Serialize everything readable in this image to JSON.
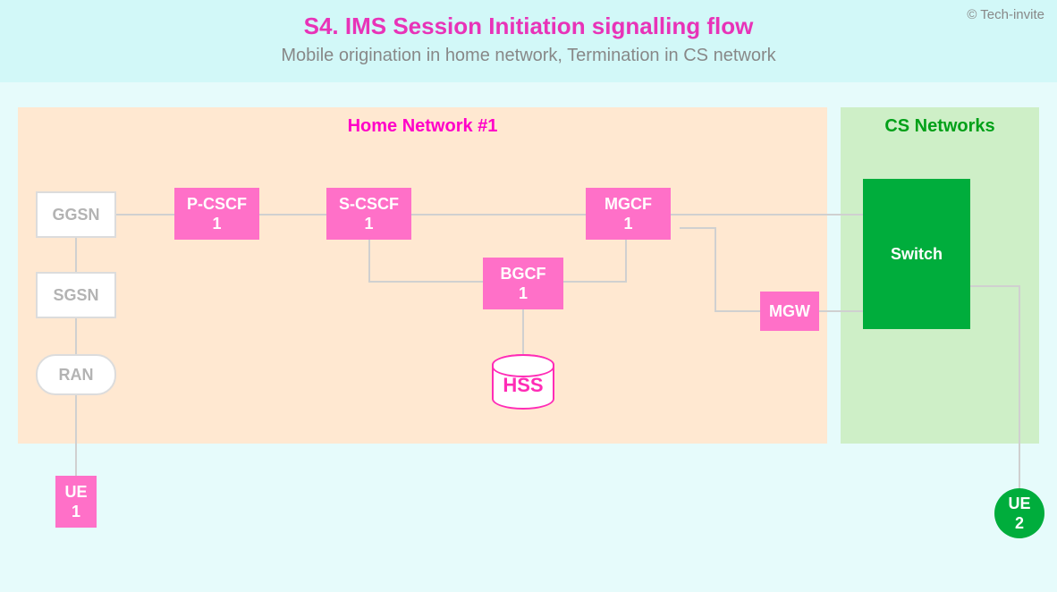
{
  "header": {
    "title": "S4. IMS Session Initiation signalling flow",
    "subtitle": "Mobile origination in home network, Termination in CS network",
    "copyright": "© Tech-invite"
  },
  "regions": {
    "home": {
      "label": "Home Network #1"
    },
    "cs": {
      "label": "CS Networks"
    }
  },
  "nodes": {
    "ggsn": "GGSN",
    "sgsn": "SGSN",
    "ran": "RAN",
    "pcscf": "P-CSCF\n1",
    "scscf": "S-CSCF\n1",
    "bgcf": "BGCF\n1",
    "mgcf": "MGCF\n1",
    "mgw": "MGW",
    "hss": "HSS",
    "switch": "Switch",
    "ue1": "UE\n1",
    "ue2": "UE\n2"
  }
}
